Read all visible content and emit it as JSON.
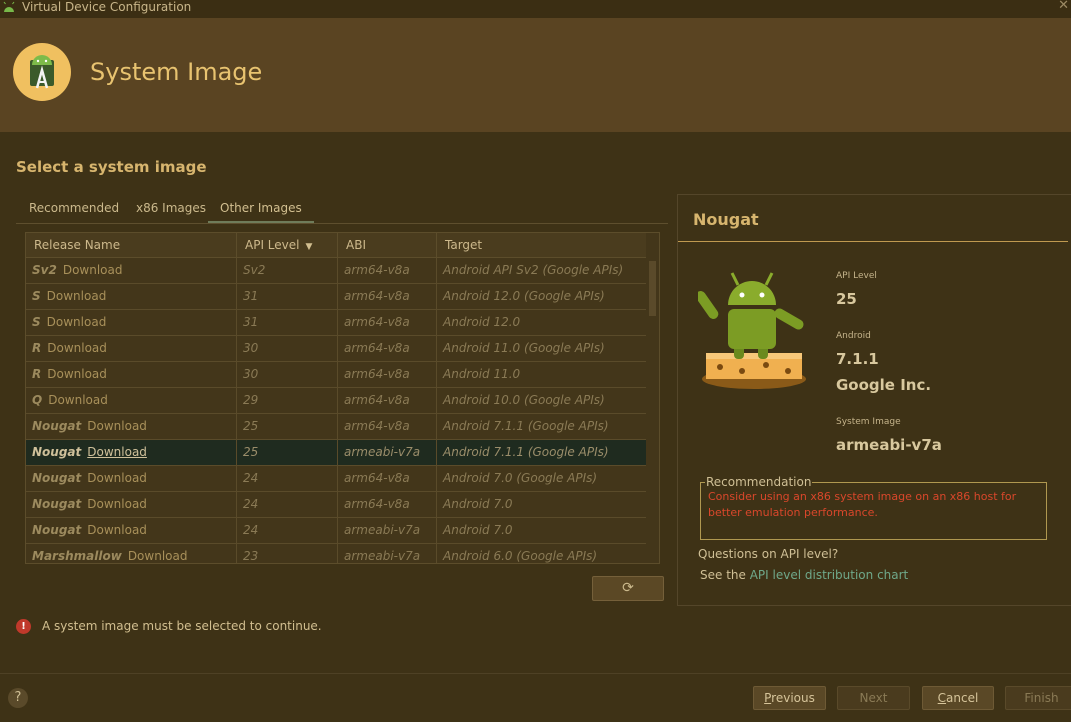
{
  "window": {
    "title": "Virtual Device Configuration"
  },
  "header": {
    "title": "System Image"
  },
  "section_title": "Select a system image",
  "tabs": [
    {
      "label": "Recommended",
      "selected": false
    },
    {
      "label": "x86 Images",
      "selected": false
    },
    {
      "label": "Other Images",
      "selected": true
    }
  ],
  "table": {
    "columns": [
      "Release Name",
      "API Level",
      "ABI",
      "Target"
    ],
    "sort_column": "API Level",
    "sort_direction": "descending",
    "rows": [
      {
        "release": "Sv2",
        "action": "Download",
        "api": "Sv2",
        "abi": "arm64-v8a",
        "target": "Android API Sv2 (Google APIs)"
      },
      {
        "release": "S",
        "action": "Download",
        "api": "31",
        "abi": "arm64-v8a",
        "target": "Android 12.0 (Google APIs)"
      },
      {
        "release": "S",
        "action": "Download",
        "api": "31",
        "abi": "arm64-v8a",
        "target": "Android 12.0"
      },
      {
        "release": "R",
        "action": "Download",
        "api": "30",
        "abi": "arm64-v8a",
        "target": "Android 11.0 (Google APIs)"
      },
      {
        "release": "R",
        "action": "Download",
        "api": "30",
        "abi": "arm64-v8a",
        "target": "Android 11.0"
      },
      {
        "release": "Q",
        "action": "Download",
        "api": "29",
        "abi": "arm64-v8a",
        "target": "Android 10.0 (Google APIs)"
      },
      {
        "release": "Nougat",
        "action": "Download",
        "api": "25",
        "abi": "arm64-v8a",
        "target": "Android 7.1.1 (Google APIs)"
      },
      {
        "release": "Nougat",
        "action": "Download",
        "api": "25",
        "abi": "armeabi-v7a",
        "target": "Android 7.1.1 (Google APIs)",
        "selected": true
      },
      {
        "release": "Nougat",
        "action": "Download",
        "api": "24",
        "abi": "arm64-v8a",
        "target": "Android 7.0 (Google APIs)"
      },
      {
        "release": "Nougat",
        "action": "Download",
        "api": "24",
        "abi": "arm64-v8a",
        "target": "Android 7.0"
      },
      {
        "release": "Nougat",
        "action": "Download",
        "api": "24",
        "abi": "armeabi-v7a",
        "target": "Android 7.0"
      },
      {
        "release": "Marshmallow",
        "action": "Download",
        "api": "23",
        "abi": "armeabi-v7a",
        "target": "Android 6.0 (Google APIs)"
      }
    ]
  },
  "error": {
    "message": "A system image must be selected to continue."
  },
  "details": {
    "title": "Nougat",
    "api_level_label": "API Level",
    "api_level": "25",
    "android_label": "Android",
    "android_version": "7.1.1",
    "vendor": "Google Inc.",
    "system_image_label": "System Image",
    "system_image": "armeabi-v7a",
    "recommendation_label": "Recommendation",
    "recommendation_text": "Consider using an x86 system image on an x86 host for better emulation performance.",
    "questions": "Questions on API level?",
    "see_prefix": "See the ",
    "link_text": "API level distribution chart"
  },
  "footer": {
    "help": "?",
    "previous": {
      "mnemonic": "P",
      "rest": "revious"
    },
    "next": "Next",
    "cancel": {
      "mnemonic": "C",
      "rest": "ancel"
    },
    "finish": "Finish"
  },
  "colors": {
    "background": "#3e3216",
    "header_bg": "#5a4422",
    "accent_gold": "#d7b56e",
    "selected_row": "#1f2b1f",
    "warning_text": "#d9472b",
    "link": "#6fa88a"
  }
}
